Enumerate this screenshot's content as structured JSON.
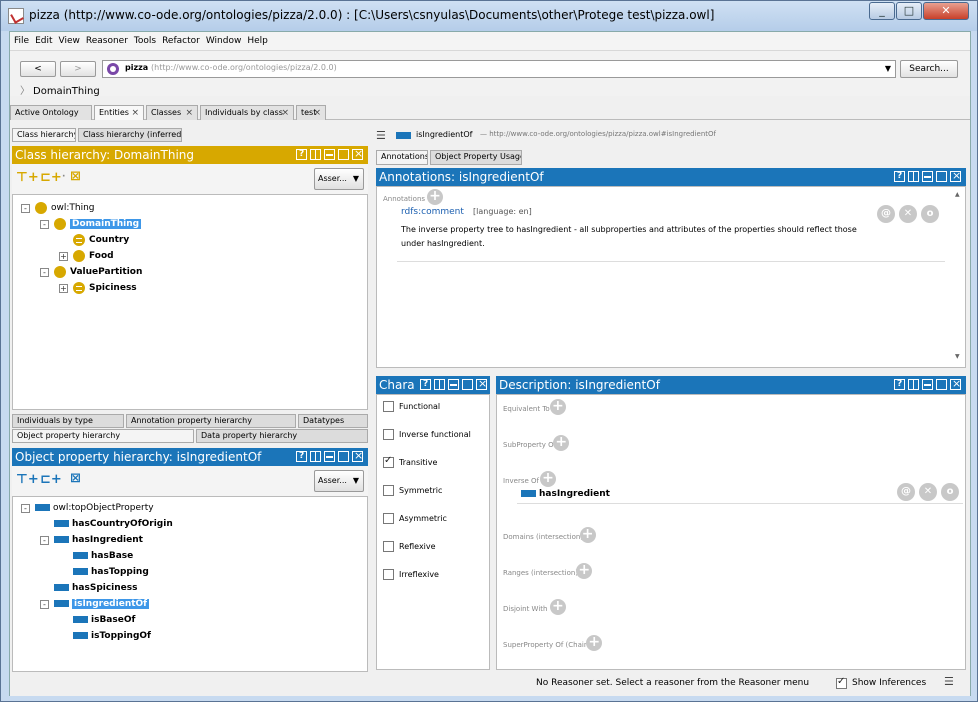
{
  "window": {
    "title": "pizza (http://www.co-ode.org/ontologies/pizza/2.0.0)  : [C:\\Users\\csnyulas\\Documents\\other\\Protege test\\pizza.owl]"
  },
  "menu": [
    "File",
    "Edit",
    "View",
    "Reasoner",
    "Tools",
    "Refactor",
    "Window",
    "Help"
  ],
  "nav": {
    "back": "<",
    "forward": ">",
    "ontology_name": "pizza",
    "ontology_iri": "(http://www.co-ode.org/ontologies/pizza/2.0.0)",
    "search": "Search...",
    "breadcrumb": "DomainThing"
  },
  "main_tabs": [
    {
      "label": "Active Ontology",
      "closable": false
    },
    {
      "label": "Entities",
      "closable": true
    },
    {
      "label": "Classes",
      "closable": true
    },
    {
      "label": "Individuals by class",
      "closable": true
    },
    {
      "label": "test",
      "closable": true
    }
  ],
  "left": {
    "class_tabs": [
      "Class hierarchy",
      "Class hierarchy (inferred)"
    ],
    "class_panel_title": "Class hierarchy: DomainThing",
    "class_tree": [
      {
        "label": "owl:Thing",
        "depth": 0,
        "exp": "-",
        "eq": false,
        "selected": false
      },
      {
        "label": "DomainThing",
        "depth": 1,
        "exp": "-",
        "eq": false,
        "selected": true
      },
      {
        "label": "Country",
        "depth": 2,
        "exp": "",
        "eq": true,
        "selected": false
      },
      {
        "label": "Food",
        "depth": 2,
        "exp": "+",
        "eq": false,
        "selected": false
      },
      {
        "label": "ValuePartition",
        "depth": 1,
        "exp": "-",
        "eq": false,
        "selected": false
      },
      {
        "label": "Spiciness",
        "depth": 2,
        "exp": "+",
        "eq": true,
        "selected": false
      }
    ],
    "asserted": "Asser...",
    "lower_tabs_row1": [
      "Individuals by type",
      "Annotation property hierarchy",
      "Datatypes"
    ],
    "lower_tabs_row2": [
      "Object property hierarchy",
      "Data property hierarchy"
    ],
    "prop_panel_title": "Object property hierarchy: isIngredientOf",
    "prop_tree": [
      {
        "label": "owl:topObjectProperty",
        "depth": 0,
        "exp": "-",
        "selected": false
      },
      {
        "label": "hasCountryOfOrigin",
        "depth": 1,
        "exp": "",
        "selected": false
      },
      {
        "label": "hasIngredient",
        "depth": 1,
        "exp": "-",
        "selected": false
      },
      {
        "label": "hasBase",
        "depth": 2,
        "exp": "",
        "selected": false
      },
      {
        "label": "hasTopping",
        "depth": 2,
        "exp": "",
        "selected": false
      },
      {
        "label": "hasSpiciness",
        "depth": 1,
        "exp": "",
        "selected": false
      },
      {
        "label": "isIngredientOf",
        "depth": 1,
        "exp": "-",
        "selected": true
      },
      {
        "label": "isBaseOf",
        "depth": 2,
        "exp": "",
        "selected": false
      },
      {
        "label": "isToppingOf",
        "depth": 2,
        "exp": "",
        "selected": false
      }
    ]
  },
  "right": {
    "entity_name": "isIngredientOf",
    "entity_iri": "— http://www.co-ode.org/ontologies/pizza/pizza.owl#isIngredientOf",
    "tabs": [
      "Annotations",
      "Object Property Usage"
    ],
    "annotations_title": "Annotations: isIngredientOf",
    "annotations_label": "Annotations",
    "annotation": {
      "property": "rdfs:comment",
      "language": "[language: en]",
      "text": "The inverse property tree to hasIngredient - all subproperties and attributes of the properties should reflect those under hasIngredient."
    },
    "characteristics_title": "Chara",
    "characteristics": [
      {
        "label": "Functional",
        "checked": false
      },
      {
        "label": "Inverse functional",
        "checked": false
      },
      {
        "label": "Transitive",
        "checked": true
      },
      {
        "label": "Symmetric",
        "checked": false
      },
      {
        "label": "Asymmetric",
        "checked": false
      },
      {
        "label": "Reflexive",
        "checked": false
      },
      {
        "label": "Irreflexive",
        "checked": false
      }
    ],
    "description_title": "Description: isIngredientOf",
    "description_sections": [
      {
        "label": "Equivalent To"
      },
      {
        "label": "SubProperty Of"
      },
      {
        "label": "Inverse Of",
        "value": "hasIngredient"
      },
      {
        "label": "Domains (intersection)"
      },
      {
        "label": "Ranges (intersection)"
      },
      {
        "label": "Disjoint With"
      },
      {
        "label": "SuperProperty Of (Chain)"
      }
    ]
  },
  "status": {
    "message": "No Reasoner set. Select a reasoner from the Reasoner menu",
    "show_inferences": "Show Inferences",
    "show_inferences_checked": true
  }
}
